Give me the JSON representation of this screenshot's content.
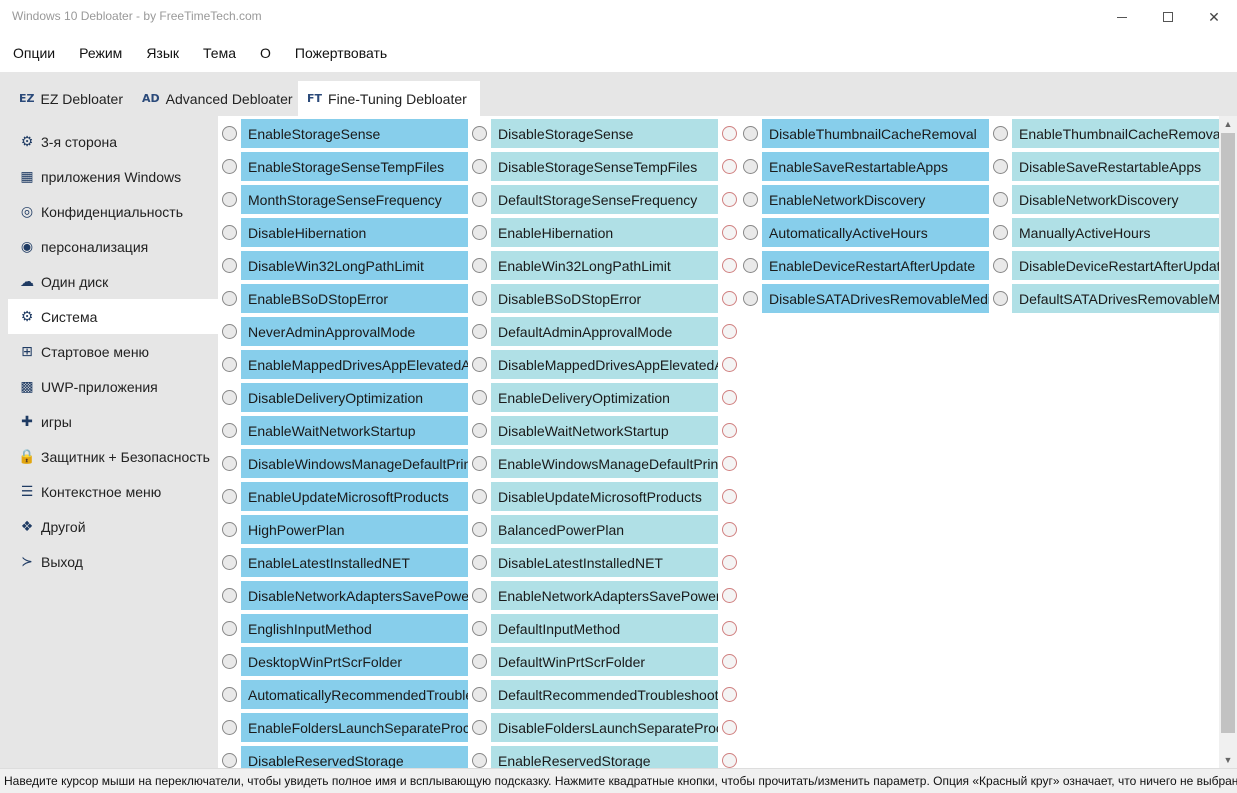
{
  "window": {
    "title": "Windows 10 Debloater - by FreeTimeTech.com",
    "min_glyph": "—",
    "close_glyph": "✕"
  },
  "menu": [
    "Опции",
    "Режим",
    "Язык",
    "Тема",
    "О",
    "Пожертвовать"
  ],
  "tabs": [
    {
      "icon": "EZ",
      "label": "EZ Debloater"
    },
    {
      "icon": "AD",
      "label": "Advanced Debloater"
    },
    {
      "icon": "FT",
      "label": "Fine-Tuning Debloater"
    }
  ],
  "sidebar": {
    "items": [
      {
        "label": "3-я сторона",
        "icon": "steam-icon",
        "glyph": "⚙"
      },
      {
        "label": "приложения Windows",
        "icon": "windows-icon",
        "glyph": "▦"
      },
      {
        "label": "Конфиденциальность",
        "icon": "fingerprint-icon",
        "glyph": "◎"
      },
      {
        "label": "персонализация",
        "icon": "user-icon",
        "glyph": "◉"
      },
      {
        "label": "Один диск",
        "icon": "cloud-icon",
        "glyph": "☁"
      },
      {
        "label": "Система",
        "icon": "gear-icon",
        "glyph": "⚙"
      },
      {
        "label": "Стартовое меню",
        "icon": "windows-icon",
        "glyph": "⊞"
      },
      {
        "label": "UWP-приложения",
        "icon": "apps-icon",
        "glyph": "▩"
      },
      {
        "label": "игры",
        "icon": "gamepad-icon",
        "glyph": "✚"
      },
      {
        "label": "Защитник + Безопасность",
        "icon": "lock-icon",
        "glyph": "🔒"
      },
      {
        "label": "Контекстное меню",
        "icon": "list-icon",
        "glyph": "☰"
      },
      {
        "label": "Другой",
        "icon": "cubes-icon",
        "glyph": "❖"
      },
      {
        "label": "Выход",
        "icon": "terminal-icon",
        "glyph": "≻"
      }
    ],
    "active": "Система"
  },
  "main": {
    "left_pairs": [
      [
        "EnableStorageSense",
        "DisableStorageSense"
      ],
      [
        "EnableStorageSenseTempFiles",
        "DisableStorageSenseTempFiles"
      ],
      [
        "MonthStorageSenseFrequency",
        "DefaultStorageSenseFrequency"
      ],
      [
        "DisableHibernation",
        "EnableHibernation"
      ],
      [
        "DisableWin32LongPathLimit",
        "EnableWin32LongPathLimit"
      ],
      [
        "EnableBSoDStopError",
        "DisableBSoDStopError"
      ],
      [
        "NeverAdminApprovalMode",
        "DefaultAdminApprovalMode"
      ],
      [
        "EnableMappedDrivesAppElevatedAccess",
        "DisableMappedDrivesAppElevatedAccess"
      ],
      [
        "DisableDeliveryOptimization",
        "EnableDeliveryOptimization"
      ],
      [
        "EnableWaitNetworkStartup",
        "DisableWaitNetworkStartup"
      ],
      [
        "DisableWindowsManageDefaultPrinter",
        "EnableWindowsManageDefaultPrinter"
      ],
      [
        "EnableUpdateMicrosoftProducts",
        "DisableUpdateMicrosoftProducts"
      ],
      [
        "HighPowerPlan",
        "BalancedPowerPlan"
      ],
      [
        "EnableLatestInstalledNET",
        "DisableLatestInstalledNET"
      ],
      [
        "DisableNetworkAdaptersSavePower",
        "EnableNetworkAdaptersSavePower"
      ],
      [
        "EnglishInputMethod",
        "DefaultInputMethod"
      ],
      [
        "DesktopWinPrtScrFolder",
        "DefaultWinPrtScrFolder"
      ],
      [
        "AutomaticallyRecommendedTroubleshooting",
        "DefaultRecommendedTroubleshooting"
      ],
      [
        "EnableFoldersLaunchSeparateProcess",
        "DisableFoldersLaunchSeparateProcess"
      ],
      [
        "DisableReservedStorage",
        "EnableReservedStorage"
      ]
    ],
    "right_pairs": [
      [
        "DisableThumbnailCacheRemoval",
        "EnableThumbnailCacheRemoval"
      ],
      [
        "EnableSaveRestartableApps",
        "DisableSaveRestartableApps"
      ],
      [
        "EnableNetworkDiscovery",
        "DisableNetworkDiscovery"
      ],
      [
        "AutomaticallyActiveHours",
        "ManuallyActiveHours"
      ],
      [
        "EnableDeviceRestartAfterUpdate",
        "DisableDeviceRestartAfterUpdate"
      ],
      [
        "DisableSATADrivesRemovableMedia",
        "DefaultSATADrivesRemovableMedia"
      ]
    ]
  },
  "colors": {
    "option_a": "#87ceeb",
    "option_b": "#b0e0e6",
    "none_circle": "#d08080"
  },
  "statusbar": {
    "text": "Наведите курсор мыши на переключатели, чтобы увидеть полное имя и всплывающую подсказку. Нажмите квадратные кнопки, чтобы прочитать/изменить параметр. Опция «Красный круг» означает, что ничего не выбрано."
  }
}
